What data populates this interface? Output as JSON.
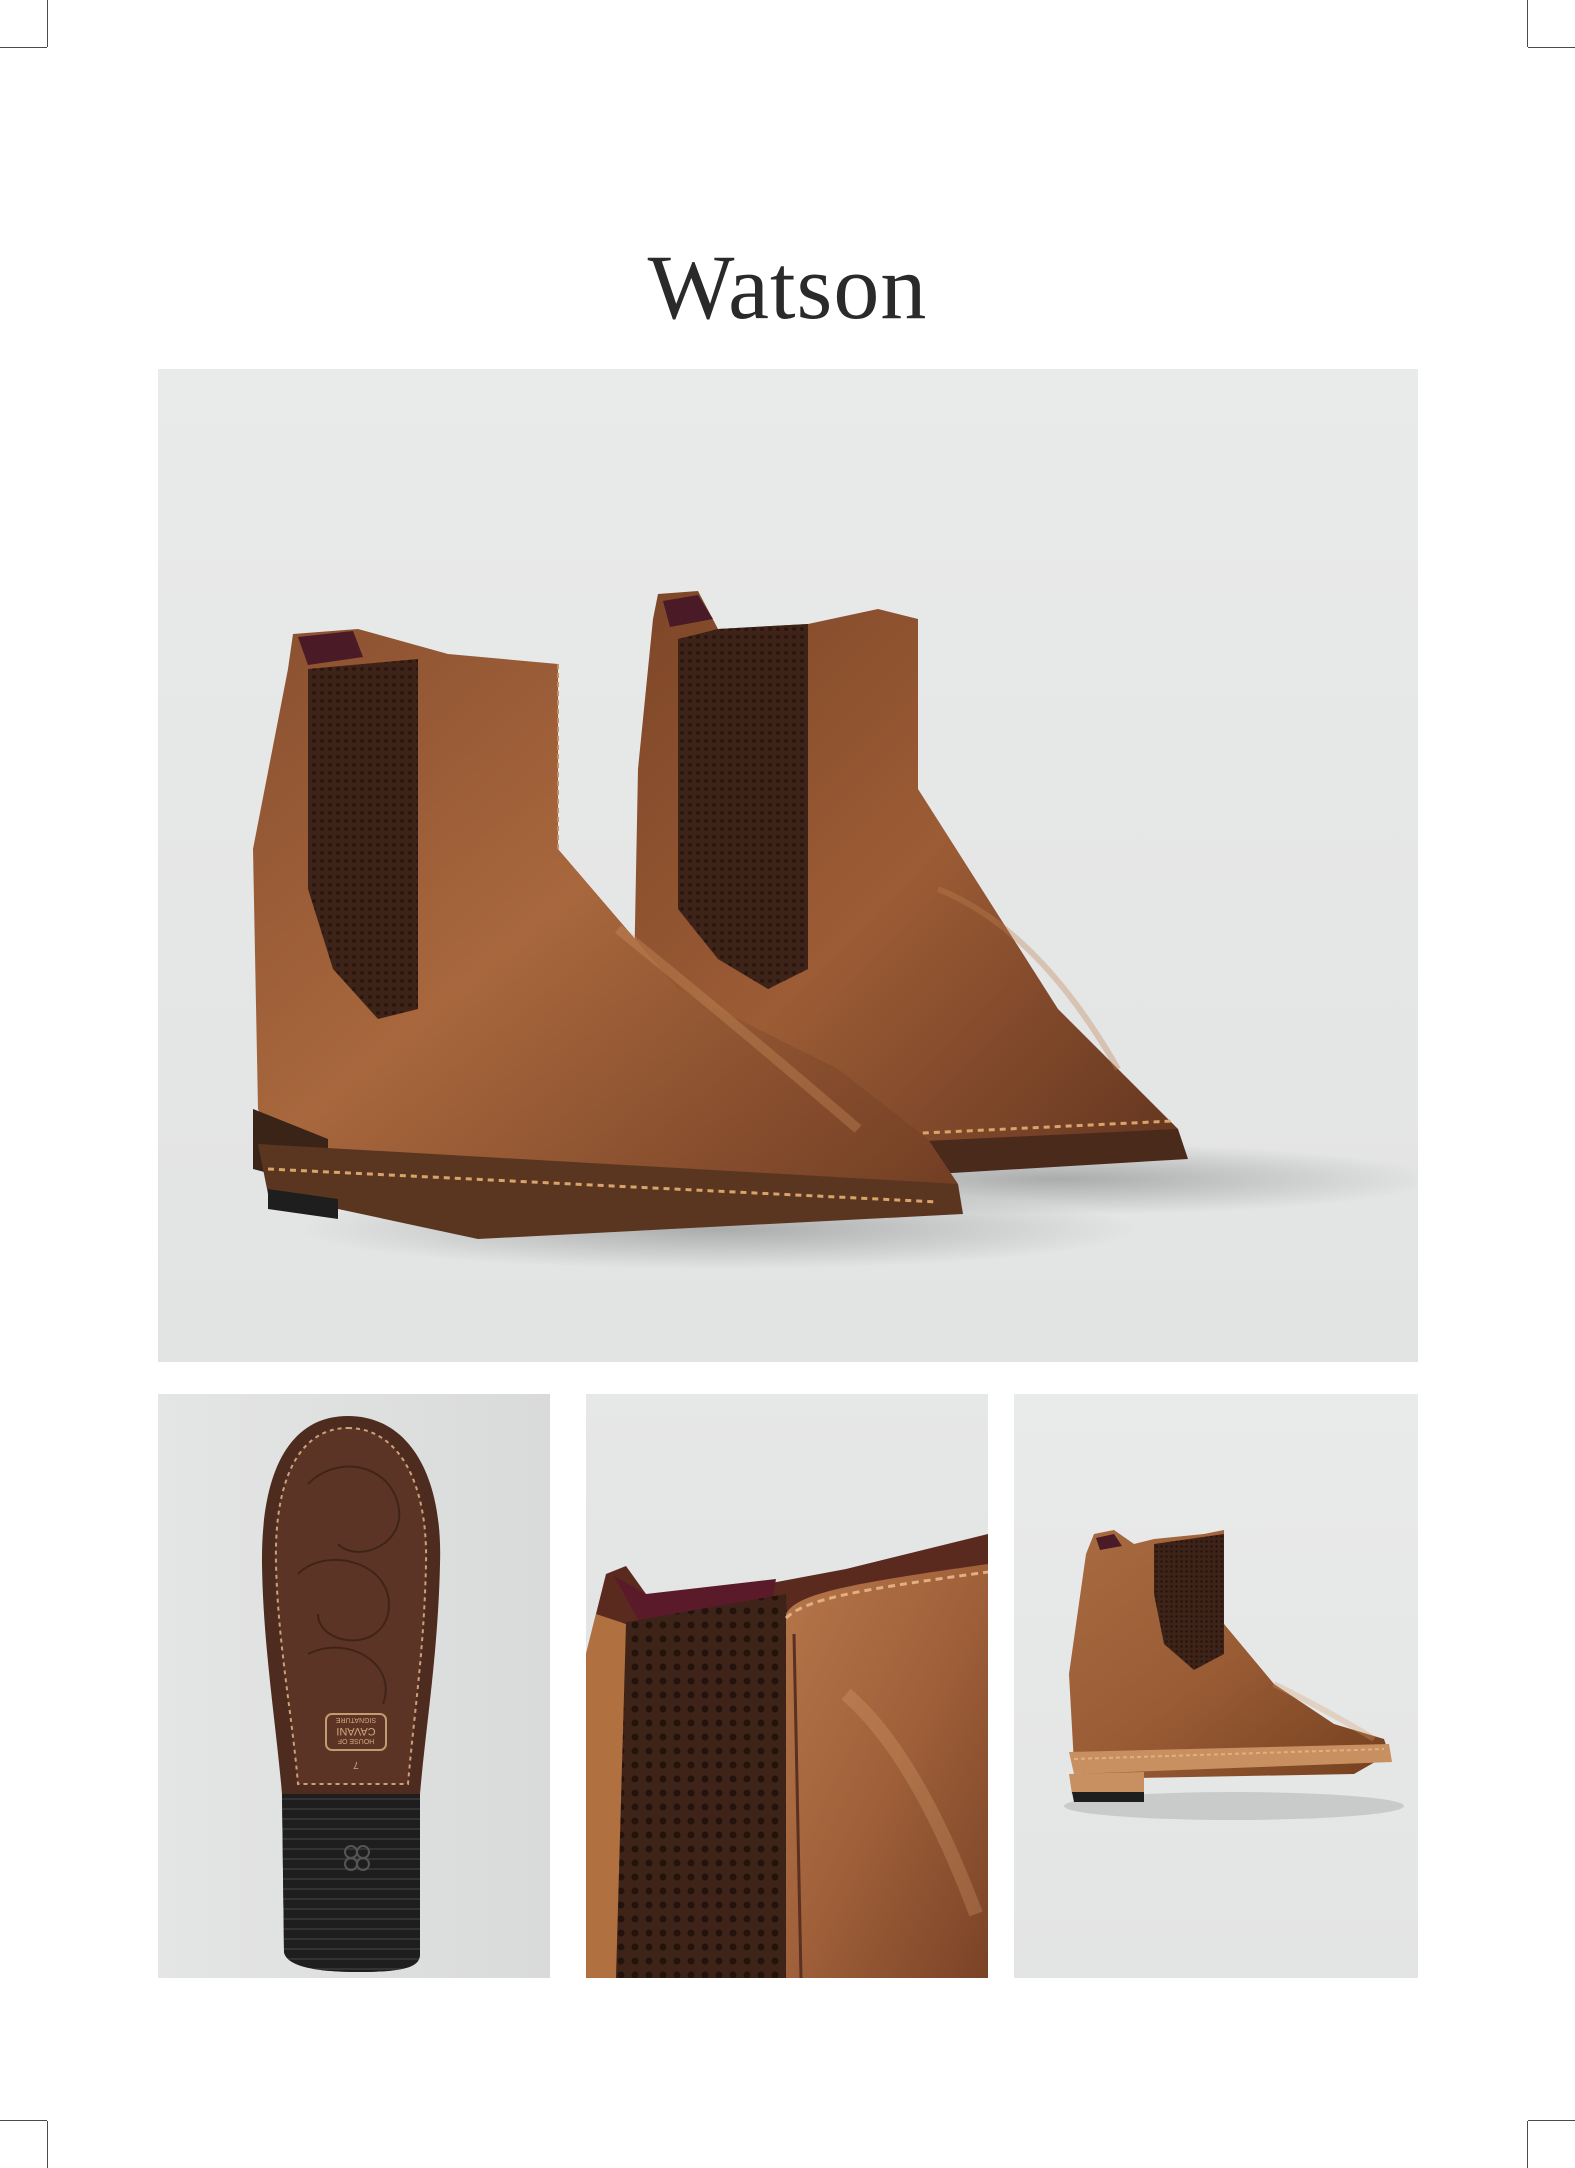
{
  "page": {
    "title": "Watson"
  },
  "sole_stamp": {
    "line1": "HOUSE OF",
    "line2": "CAVANI",
    "line3": "SIGNATURE",
    "size": "7"
  },
  "colors": {
    "background": "#ffffff",
    "photo_backdrop": "#e6e7e7",
    "leather": "#9a5a33",
    "leather_dark": "#6b3a1f",
    "elastic": "#3d2218",
    "lining": "#5a1a2a",
    "sole_rubber": "#1e1e1e"
  },
  "photos": [
    {
      "name": "hero-pair"
    },
    {
      "name": "sole-detail"
    },
    {
      "name": "heel-detail"
    },
    {
      "name": "side-view"
    }
  ]
}
